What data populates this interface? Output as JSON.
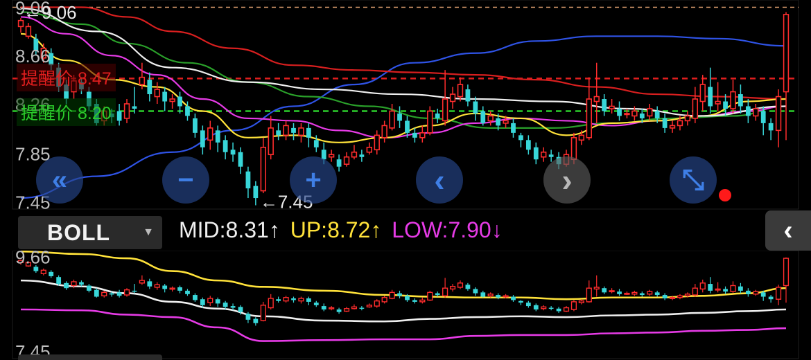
{
  "colors": {
    "up": "#ff2d2d",
    "down": "#38d6d8",
    "ma_white": "#eeeeee",
    "ma_yellow": "#ffe23a",
    "ma_magenta": "#e63be6",
    "ma_green": "#2aa02a",
    "ma_red": "#d81f1f",
    "ma_blue": "#2f53e6",
    "alert_red": "#e01e1e",
    "alert_green": "#2bcc2b",
    "ref_line": "#e0a070"
  },
  "main_axis": {
    "labels": [
      "9.06",
      "8.66",
      "8.26",
      "7.85",
      "7.45"
    ],
    "hi_marker": "9.06",
    "lo_marker": "7.45"
  },
  "alerts": [
    {
      "label": "提醒价",
      "value": "8.47",
      "color": "red"
    },
    {
      "label": "提醒价",
      "value": "8.20",
      "color": "green"
    }
  ],
  "controls": [
    {
      "name": "zoom-out-far-icon",
      "glyph": "«",
      "style": "blue"
    },
    {
      "name": "zoom-minus-icon",
      "glyph": "−",
      "style": "blue"
    },
    {
      "name": "zoom-plus-icon",
      "glyph": "+",
      "style": "blue"
    },
    {
      "name": "prev-icon",
      "glyph": "‹",
      "style": "blue"
    },
    {
      "name": "next-icon",
      "glyph": "›",
      "style": "gray"
    },
    {
      "name": "fullscreen-icon",
      "glyph": "⤡",
      "style": "blue"
    }
  ],
  "indicator": {
    "name": "BOLL",
    "caret": "▼",
    "mid": "MID:8.31↑",
    "up": "UP:8.72↑",
    "low": "LOW:7.90↓",
    "collapse": "‹"
  },
  "sub_axis": {
    "labels": [
      "9.66",
      "7.45"
    ]
  },
  "chart_data": {
    "type": "candlestick",
    "ylim": [
      7.4,
      9.12
    ],
    "candles": [
      [
        8.9,
        8.95,
        8.85,
        8.97
      ],
      [
        8.82,
        8.9,
        8.8,
        8.93
      ],
      [
        8.8,
        8.7,
        8.66,
        8.84
      ],
      [
        8.64,
        8.72,
        8.6,
        8.76
      ],
      [
        8.68,
        8.58,
        8.54,
        8.72
      ],
      [
        8.56,
        8.4,
        8.36,
        8.6
      ],
      [
        8.42,
        8.3,
        8.26,
        8.46
      ],
      [
        8.36,
        8.45,
        8.3,
        8.5
      ],
      [
        8.44,
        8.38,
        8.34,
        8.48
      ],
      [
        8.36,
        8.24,
        8.2,
        8.4
      ],
      [
        8.26,
        8.1,
        8.08,
        8.3
      ],
      [
        8.12,
        8.2,
        8.08,
        8.24
      ],
      [
        8.18,
        8.15,
        8.1,
        8.22
      ],
      [
        8.2,
        8.12,
        8.08,
        8.26
      ],
      [
        8.14,
        8.26,
        8.1,
        8.3
      ],
      [
        8.24,
        8.22,
        8.18,
        8.4
      ],
      [
        8.42,
        8.48,
        8.38,
        8.6
      ],
      [
        8.46,
        8.34,
        8.28,
        8.52
      ],
      [
        8.32,
        8.38,
        8.26,
        8.44
      ],
      [
        8.36,
        8.28,
        8.2,
        8.4
      ],
      [
        8.28,
        8.3,
        8.22,
        8.34
      ],
      [
        8.32,
        8.24,
        8.18,
        8.36
      ],
      [
        8.24,
        8.16,
        8.12,
        8.28
      ],
      [
        8.14,
        8.02,
        7.98,
        8.18
      ],
      [
        8.04,
        7.9,
        7.84,
        8.08
      ],
      [
        7.96,
        8.06,
        7.88,
        8.12
      ],
      [
        8.04,
        7.94,
        7.86,
        8.08
      ],
      [
        7.96,
        7.86,
        7.8,
        8.0
      ],
      [
        7.88,
        7.84,
        7.78,
        7.94
      ],
      [
        7.86,
        7.74,
        7.68,
        7.9
      ],
      [
        7.7,
        7.56,
        7.48,
        7.74
      ],
      [
        7.58,
        7.48,
        7.42,
        7.62
      ],
      [
        7.54,
        7.9,
        7.52,
        7.98
      ],
      [
        7.84,
        8.06,
        7.8,
        8.16
      ],
      [
        8.04,
        8.0,
        7.96,
        8.1
      ],
      [
        8.0,
        8.08,
        7.96,
        8.12
      ],
      [
        8.06,
        8.02,
        7.96,
        8.1
      ],
      [
        8.0,
        8.06,
        7.94,
        8.1
      ],
      [
        8.06,
        7.98,
        7.9,
        8.1
      ],
      [
        7.96,
        7.9,
        7.86,
        8.0
      ],
      [
        7.88,
        7.8,
        7.76,
        7.94
      ],
      [
        7.82,
        7.84,
        7.78,
        7.88
      ],
      [
        7.8,
        7.74,
        7.7,
        7.84
      ],
      [
        7.76,
        7.82,
        7.74,
        7.86
      ],
      [
        7.82,
        7.86,
        7.8,
        7.92
      ],
      [
        7.84,
        7.82,
        7.78,
        7.88
      ],
      [
        7.86,
        7.9,
        7.84,
        7.94
      ],
      [
        7.88,
        8.0,
        7.84,
        8.04
      ],
      [
        7.98,
        8.08,
        7.94,
        8.12
      ],
      [
        8.06,
        8.2,
        8.04,
        8.26
      ],
      [
        8.18,
        8.12,
        8.06,
        8.24
      ],
      [
        8.12,
        8.02,
        7.98,
        8.16
      ],
      [
        8.02,
        7.98,
        7.94,
        8.06
      ],
      [
        7.98,
        8.02,
        7.94,
        8.08
      ],
      [
        8.02,
        8.2,
        8.0,
        8.24
      ],
      [
        8.18,
        8.14,
        8.1,
        8.22
      ],
      [
        8.12,
        8.3,
        8.08,
        8.54
      ],
      [
        8.28,
        8.34,
        8.22,
        8.4
      ],
      [
        8.32,
        8.42,
        8.28,
        8.48
      ],
      [
        8.38,
        8.28,
        8.24,
        8.42
      ],
      [
        8.28,
        8.18,
        8.12,
        8.32
      ],
      [
        8.2,
        8.1,
        8.08,
        8.24
      ],
      [
        8.12,
        8.16,
        8.08,
        8.2
      ],
      [
        8.14,
        8.08,
        8.04,
        8.18
      ],
      [
        8.1,
        8.12,
        8.06,
        8.16
      ],
      [
        8.1,
        8.02,
        7.98,
        8.14
      ],
      [
        8.0,
        7.96,
        7.9,
        8.02
      ],
      [
        7.96,
        7.88,
        7.84,
        8.0
      ],
      [
        7.9,
        7.8,
        7.76,
        7.94
      ],
      [
        7.82,
        7.86,
        7.78,
        7.9
      ],
      [
        7.84,
        7.82,
        7.78,
        7.88
      ],
      [
        7.82,
        7.76,
        7.72,
        7.86
      ],
      [
        7.76,
        7.84,
        7.74,
        7.88
      ],
      [
        7.8,
        7.98,
        7.76,
        8.02
      ],
      [
        7.96,
        8.0,
        7.92,
        8.04
      ],
      [
        7.98,
        8.3,
        7.96,
        8.48
      ],
      [
        8.28,
        8.32,
        8.1,
        8.6
      ],
      [
        8.3,
        8.2,
        8.16,
        8.34
      ],
      [
        8.22,
        8.24,
        8.18,
        8.3
      ],
      [
        8.22,
        8.16,
        8.12,
        8.28
      ],
      [
        8.18,
        8.18,
        8.14,
        8.22
      ],
      [
        8.16,
        8.2,
        8.12,
        8.24
      ],
      [
        8.18,
        8.14,
        8.1,
        8.22
      ],
      [
        8.16,
        8.22,
        8.12,
        8.26
      ],
      [
        8.2,
        8.14,
        8.1,
        8.24
      ],
      [
        8.14,
        8.06,
        8.02,
        8.18
      ],
      [
        8.06,
        8.08,
        8.02,
        8.12
      ],
      [
        8.08,
        8.12,
        8.04,
        8.16
      ],
      [
        8.12,
        8.16,
        8.08,
        8.2
      ],
      [
        8.14,
        8.3,
        8.1,
        8.4
      ],
      [
        8.28,
        8.42,
        8.2,
        8.5
      ],
      [
        8.4,
        8.24,
        8.18,
        8.56
      ],
      [
        8.26,
        8.28,
        8.2,
        8.44
      ],
      [
        8.28,
        8.22,
        8.16,
        8.34
      ],
      [
        8.22,
        8.36,
        8.18,
        8.46
      ],
      [
        8.34,
        8.24,
        8.18,
        8.42
      ],
      [
        8.24,
        8.16,
        8.1,
        8.3
      ],
      [
        8.16,
        8.22,
        8.12,
        8.26
      ],
      [
        8.2,
        8.1,
        8.0,
        8.24
      ],
      [
        8.1,
        8.04,
        7.96,
        8.14
      ],
      [
        8.04,
        8.32,
        7.9,
        8.38
      ],
      [
        8.36,
        9.0,
        7.96,
        9.02
      ]
    ],
    "sub_ylim": [
      7.3,
      9.8
    ],
    "boll": {
      "up": [
        [
          0,
          9.78
        ],
        [
          8,
          9.72
        ],
        [
          14,
          9.62
        ],
        [
          20,
          9.32
        ],
        [
          26,
          9.1
        ],
        [
          32,
          8.95
        ],
        [
          40,
          8.86
        ],
        [
          48,
          8.76
        ],
        [
          54,
          8.72
        ],
        [
          60,
          8.7
        ],
        [
          66,
          8.7
        ],
        [
          72,
          8.66
        ],
        [
          78,
          8.7
        ],
        [
          84,
          8.7
        ],
        [
          90,
          8.74
        ],
        [
          96,
          8.8
        ],
        [
          101,
          8.92
        ]
      ],
      "mid": [
        [
          0,
          9.1
        ],
        [
          8,
          8.96
        ],
        [
          14,
          8.8
        ],
        [
          20,
          8.6
        ],
        [
          26,
          8.44
        ],
        [
          32,
          8.26
        ],
        [
          40,
          8.16
        ],
        [
          48,
          8.14
        ],
        [
          54,
          8.2
        ],
        [
          60,
          8.24
        ],
        [
          66,
          8.26
        ],
        [
          72,
          8.24
        ],
        [
          78,
          8.28
        ],
        [
          84,
          8.3
        ],
        [
          90,
          8.34
        ],
        [
          96,
          8.38
        ],
        [
          101,
          8.42
        ]
      ],
      "low": [
        [
          0,
          8.42
        ],
        [
          8,
          8.4
        ],
        [
          14,
          8.3
        ],
        [
          20,
          8.24
        ],
        [
          26,
          8.0
        ],
        [
          32,
          7.68
        ],
        [
          40,
          7.7
        ],
        [
          48,
          7.72
        ],
        [
          54,
          7.72
        ],
        [
          60,
          7.8
        ],
        [
          66,
          7.82
        ],
        [
          72,
          7.82
        ],
        [
          78,
          7.86
        ],
        [
          84,
          7.88
        ],
        [
          90,
          7.92
        ],
        [
          96,
          7.94
        ],
        [
          101,
          7.98
        ]
      ]
    },
    "ma": {
      "white": [
        [
          0,
          9.05
        ],
        [
          10,
          8.86
        ],
        [
          20,
          8.56
        ],
        [
          30,
          8.44
        ],
        [
          40,
          8.38
        ],
        [
          50,
          8.34
        ],
        [
          60,
          8.3
        ],
        [
          70,
          8.28
        ],
        [
          80,
          8.22
        ],
        [
          90,
          8.16
        ],
        [
          101,
          8.24
        ]
      ],
      "yellow": [
        [
          0,
          8.84
        ],
        [
          6,
          8.62
        ],
        [
          12,
          8.46
        ],
        [
          18,
          8.4
        ],
        [
          24,
          8.2
        ],
        [
          30,
          7.98
        ],
        [
          36,
          8.0
        ],
        [
          42,
          7.94
        ],
        [
          48,
          7.98
        ],
        [
          54,
          8.08
        ],
        [
          60,
          8.18
        ],
        [
          66,
          8.14
        ],
        [
          72,
          8.0
        ],
        [
          78,
          8.1
        ],
        [
          84,
          8.12
        ],
        [
          90,
          8.16
        ],
        [
          96,
          8.28
        ],
        [
          101,
          8.3
        ]
      ],
      "magenta": [
        [
          0,
          8.98
        ],
        [
          6,
          8.84
        ],
        [
          12,
          8.66
        ],
        [
          18,
          8.5
        ],
        [
          24,
          8.3
        ],
        [
          30,
          8.14
        ],
        [
          36,
          8.12
        ],
        [
          42,
          8.04
        ],
        [
          48,
          7.98
        ],
        [
          54,
          8.02
        ],
        [
          60,
          8.1
        ],
        [
          66,
          8.14
        ],
        [
          72,
          8.12
        ],
        [
          78,
          8.08
        ],
        [
          84,
          8.12
        ],
        [
          90,
          8.16
        ],
        [
          96,
          8.2
        ],
        [
          101,
          8.24
        ]
      ],
      "green": [
        [
          0,
          9.02
        ],
        [
          8,
          8.92
        ],
        [
          14,
          8.76
        ],
        [
          22,
          8.6
        ],
        [
          30,
          8.44
        ],
        [
          38,
          8.32
        ],
        [
          46,
          8.24
        ],
        [
          54,
          8.14
        ],
        [
          62,
          8.06
        ],
        [
          70,
          8.06
        ],
        [
          78,
          8.1
        ],
        [
          86,
          8.14
        ],
        [
          94,
          8.16
        ],
        [
          101,
          8.24
        ]
      ],
      "red": [
        [
          0,
          9.06
        ],
        [
          8,
          9.06
        ],
        [
          14,
          8.98
        ],
        [
          20,
          8.86
        ],
        [
          28,
          8.72
        ],
        [
          36,
          8.58
        ],
        [
          44,
          8.54
        ],
        [
          52,
          8.52
        ],
        [
          60,
          8.5
        ],
        [
          68,
          8.46
        ],
        [
          76,
          8.4
        ],
        [
          84,
          8.34
        ],
        [
          92,
          8.32
        ],
        [
          101,
          8.3
        ]
      ],
      "blue": [
        [
          0,
          7.48
        ],
        [
          10,
          7.66
        ],
        [
          20,
          7.86
        ],
        [
          28,
          8.04
        ],
        [
          36,
          8.24
        ],
        [
          44,
          8.42
        ],
        [
          52,
          8.6
        ],
        [
          60,
          8.68
        ],
        [
          68,
          8.78
        ],
        [
          76,
          8.82
        ],
        [
          84,
          8.82
        ],
        [
          92,
          8.8
        ],
        [
          101,
          8.74
        ]
      ]
    }
  }
}
